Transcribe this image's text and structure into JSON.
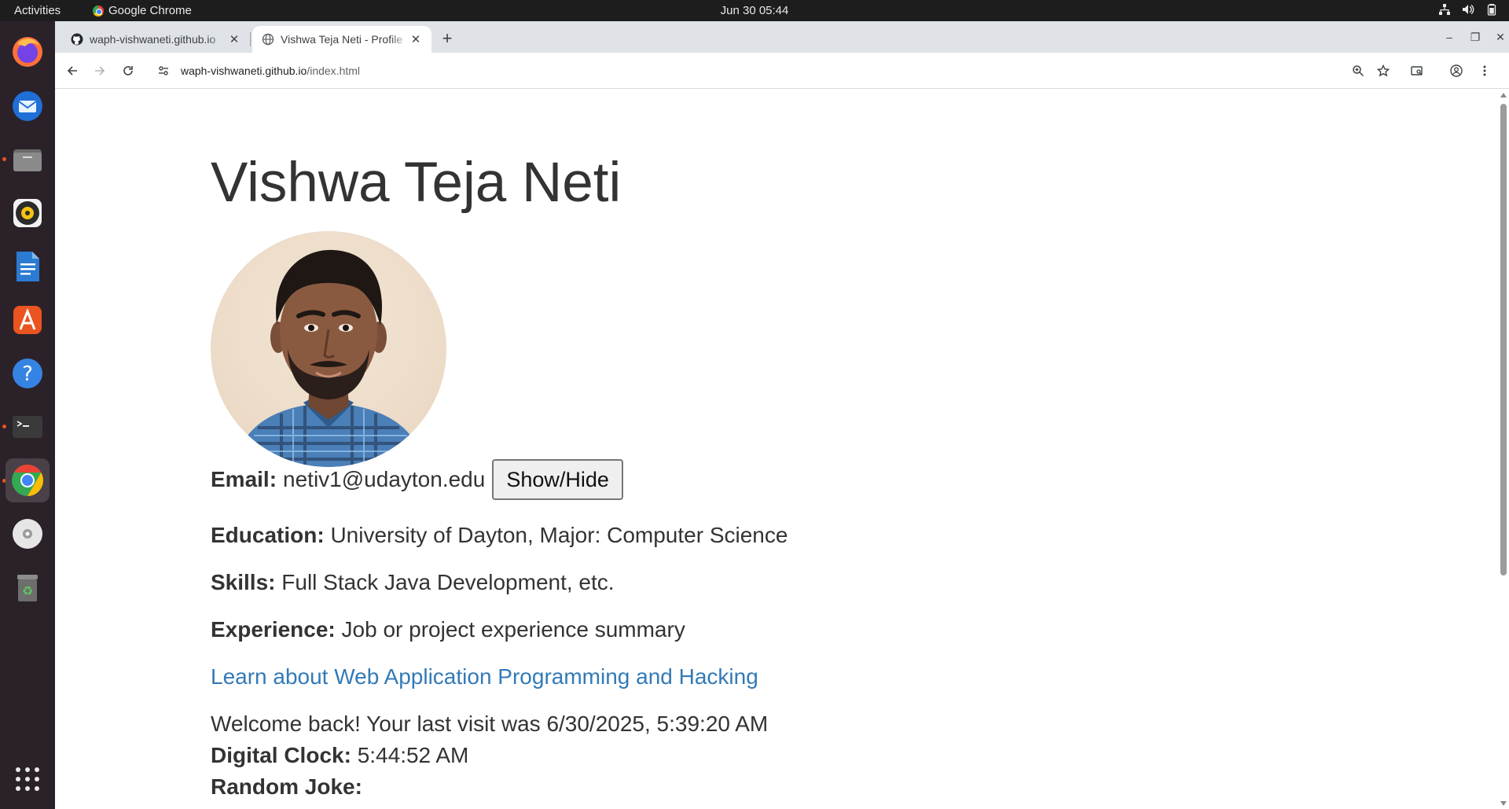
{
  "system": {
    "activities_label": "Activities",
    "app_name": "Google Chrome",
    "datetime": "Jun 30  05:44"
  },
  "dock": {
    "items": [
      "Firefox",
      "Thunderbird",
      "Files",
      "Rhythmbox",
      "LibreOffice Writer",
      "App Center",
      "Help",
      "Terminal",
      "Google Chrome",
      "Disc",
      "Trash",
      "Show Apps"
    ]
  },
  "browser": {
    "tabs": [
      {
        "title": "waph-vishwaneti.github.io",
        "icon": "github-icon",
        "active": false
      },
      {
        "title": "Vishwa Teja Neti - Profile",
        "icon": "globe-icon",
        "active": true
      }
    ],
    "url_host": "waph-vishwaneti.github.io",
    "url_path": "/index.html"
  },
  "page": {
    "name": "Vishwa Teja Neti",
    "email_label": "Email:",
    "email_value": "netiv1@udayton.edu",
    "show_hide_label": "Show/Hide",
    "education_label": "Education:",
    "education_value": "University of Dayton, Major: Computer Science",
    "skills_label": "Skills:",
    "skills_value": "Full Stack Java Development, etc.",
    "experience_label": "Experience:",
    "experience_value": "Job or project experience summary",
    "course_link": "Learn about Web Application Programming and Hacking",
    "welcome_text": "Welcome back! Your last visit was 6/30/2025, 5:39:20 AM",
    "clock_label": "Digital Clock:",
    "clock_value": "5:44:52 AM",
    "joke_label": "Random Joke:"
  },
  "colors": {
    "link": "#337ab7",
    "text": "#333333",
    "dock_bg": "#2b2129",
    "topbar_bg": "#1d1d1d",
    "tabstrip_bg": "#dfe3e8"
  }
}
